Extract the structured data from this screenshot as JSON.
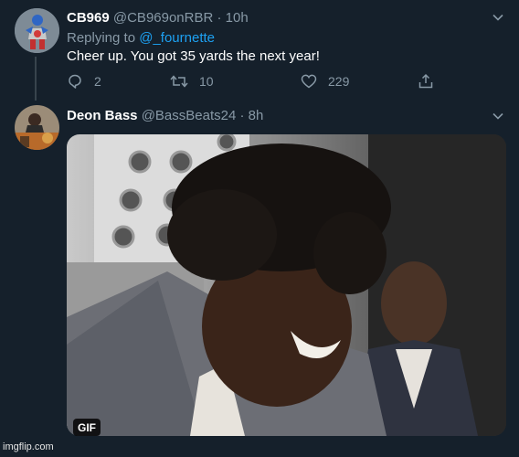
{
  "tweet1": {
    "display_name": "CB969",
    "handle": "@CB969onRBR",
    "separator": "·",
    "time": "10h",
    "replying_to_prefix": "Replying to ",
    "replying_to_handle": "@_fournette",
    "text": "Cheer up. You got 35 yards the next year!",
    "replies": "2",
    "retweets": "10",
    "likes": "229"
  },
  "tweet2": {
    "display_name": "Deon Bass",
    "handle": "@BassBeats24",
    "separator": "·",
    "time": "8h",
    "media_badge": "GIF"
  },
  "watermark": "imgflip.com",
  "icons": {
    "caret": "chevron-down-icon",
    "reply": "reply-icon",
    "retweet": "retweet-icon",
    "like": "heart-icon",
    "share": "share-icon"
  },
  "colors": {
    "background": "#15202b",
    "secondary_text": "#8899a6",
    "link": "#1da1f2",
    "divider": "#38444d"
  }
}
